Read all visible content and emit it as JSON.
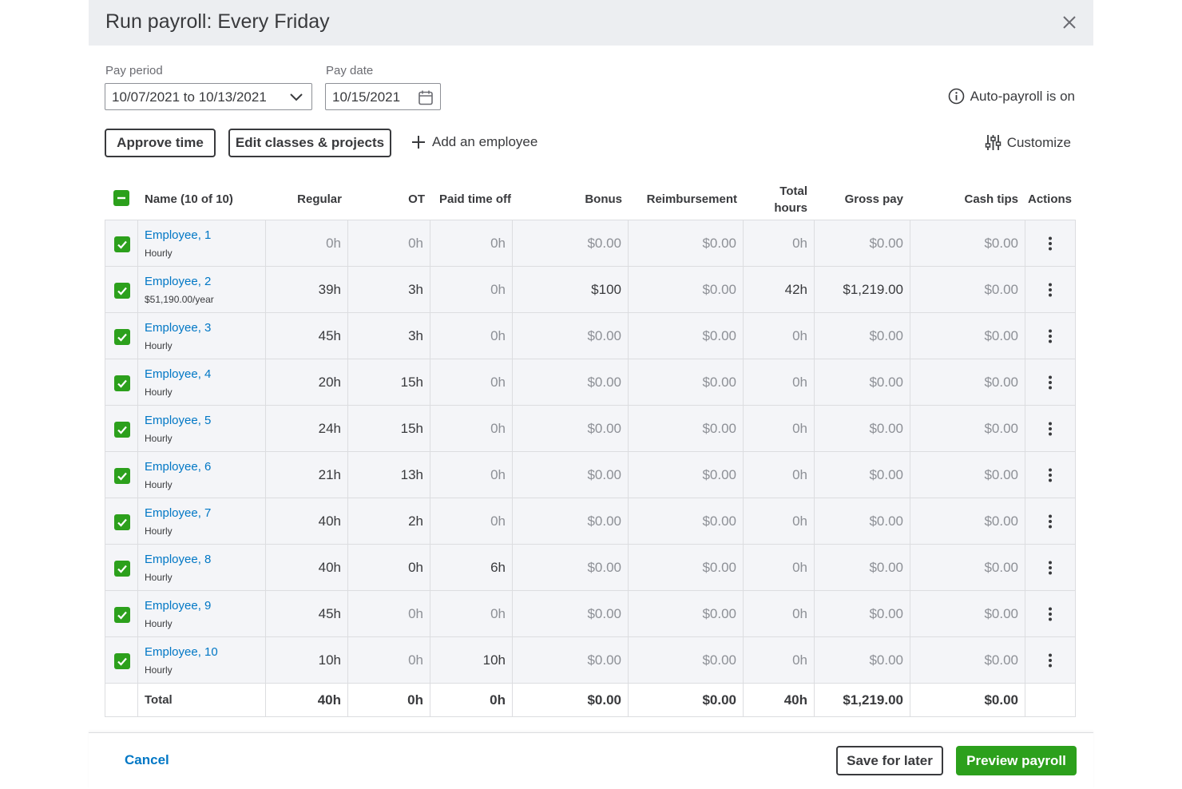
{
  "modal": {
    "title": "Run payroll: Every Friday"
  },
  "pay_period": {
    "label": "Pay period",
    "value": "10/07/2021 to 10/13/2021"
  },
  "pay_date": {
    "label": "Pay date",
    "value": "10/15/2021"
  },
  "auto_payroll": "Auto-payroll is on",
  "toolbar": {
    "approve_time": "Approve time",
    "edit_classes": "Edit classes & projects",
    "add_employee": "Add an employee",
    "customize": "Customize"
  },
  "columns": {
    "name": "Name (10 of 10)",
    "regular": "Regular",
    "ot": "OT",
    "pto": "Paid time off",
    "bonus": "Bonus",
    "reimbursement": "Reimbursement",
    "total_hours_1": "Total",
    "total_hours_2": "hours",
    "gross": "Gross pay",
    "tips": "Cash tips",
    "actions": "Actions"
  },
  "rows": [
    {
      "name": "Employee, 1",
      "type": "Hourly",
      "regular": "0h",
      "ot": "0h",
      "pto": "0h",
      "bonus": "$0.00",
      "reimb": "$0.00",
      "total": "0h",
      "gross": "$0.00",
      "tips": "$0.00",
      "hi": []
    },
    {
      "name": "Employee, 2",
      "type": "$51,190.00/year",
      "regular": "39h",
      "ot": "3h",
      "pto": "0h",
      "bonus": "$100",
      "reimb": "$0.00",
      "total": "42h",
      "gross": "$1,219.00",
      "tips": "$0.00",
      "hi": [
        "regular",
        "ot",
        "bonus",
        "total",
        "gross"
      ]
    },
    {
      "name": "Employee, 3",
      "type": "Hourly",
      "regular": "45h",
      "ot": "3h",
      "pto": "0h",
      "bonus": "$0.00",
      "reimb": "$0.00",
      "total": "0h",
      "gross": "$0.00",
      "tips": "$0.00",
      "hi": [
        "regular",
        "ot"
      ]
    },
    {
      "name": "Employee, 4",
      "type": "Hourly",
      "regular": "20h",
      "ot": "15h",
      "pto": "0h",
      "bonus": "$0.00",
      "reimb": "$0.00",
      "total": "0h",
      "gross": "$0.00",
      "tips": "$0.00",
      "hi": [
        "regular",
        "ot"
      ]
    },
    {
      "name": "Employee, 5",
      "type": "Hourly",
      "regular": "24h",
      "ot": "15h",
      "pto": "0h",
      "bonus": "$0.00",
      "reimb": "$0.00",
      "total": "0h",
      "gross": "$0.00",
      "tips": "$0.00",
      "hi": [
        "regular",
        "ot"
      ]
    },
    {
      "name": "Employee, 6",
      "type": "Hourly",
      "regular": "21h",
      "ot": "13h",
      "pto": "0h",
      "bonus": "$0.00",
      "reimb": "$0.00",
      "total": "0h",
      "gross": "$0.00",
      "tips": "$0.00",
      "hi": [
        "regular",
        "ot"
      ]
    },
    {
      "name": "Employee, 7",
      "type": "Hourly",
      "regular": "40h",
      "ot": "2h",
      "pto": "0h",
      "bonus": "$0.00",
      "reimb": "$0.00",
      "total": "0h",
      "gross": "$0.00",
      "tips": "$0.00",
      "hi": [
        "regular",
        "ot"
      ]
    },
    {
      "name": "Employee, 8",
      "type": "Hourly",
      "regular": "40h",
      "ot": "0h",
      "pto": "6h",
      "bonus": "$0.00",
      "reimb": "$0.00",
      "total": "0h",
      "gross": "$0.00",
      "tips": "$0.00",
      "hi": [
        "regular",
        "ot",
        "pto"
      ]
    },
    {
      "name": "Employee, 9",
      "type": "Hourly",
      "regular": "45h",
      "ot": "0h",
      "pto": "0h",
      "bonus": "$0.00",
      "reimb": "$0.00",
      "total": "0h",
      "gross": "$0.00",
      "tips": "$0.00",
      "hi": [
        "regular"
      ]
    },
    {
      "name": "Employee, 10",
      "type": "Hourly",
      "regular": "10h",
      "ot": "0h",
      "pto": "10h",
      "bonus": "$0.00",
      "reimb": "$0.00",
      "total": "0h",
      "gross": "$0.00",
      "tips": "$0.00",
      "hi": [
        "regular",
        "pto"
      ]
    }
  ],
  "totals": {
    "label": "Total",
    "regular": "40h",
    "ot": "0h",
    "pto": "0h",
    "bonus": "$0.00",
    "reimb": "$0.00",
    "total": "40h",
    "gross": "$1,219.00",
    "tips": "$0.00"
  },
  "footer": {
    "cancel": "Cancel",
    "save_for_later": "Save for later",
    "preview": "Preview payroll"
  },
  "colors": {
    "accent_green": "#2ca01c",
    "link_blue": "#0077c5",
    "text_dark": "#393a3d",
    "header_bg": "#eceef1"
  }
}
